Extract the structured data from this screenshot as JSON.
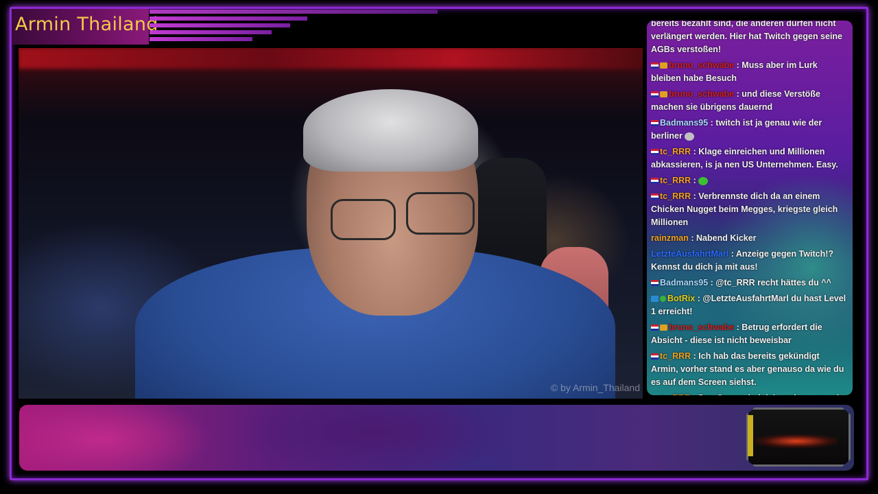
{
  "stream": {
    "title": "Armin Thailand",
    "watermark": "© by Armin_Thailand"
  },
  "chat": {
    "messages": [
      {
        "user": "",
        "color": "#ffffff",
        "text": "bereits bezahlt sind, die anderen dürfen nicht verlängert werden. Hier hat Twitch gegen seine AGBs verstoßen!",
        "badges": []
      },
      {
        "user": "bruno_schwabe",
        "color": "#cc2020",
        "text": ": Muss aber im Lurk bleiben habe Besuch",
        "badges": [
          "flag-icon",
          "crown-icon"
        ]
      },
      {
        "user": "bruno_schwabe",
        "color": "#cc2020",
        "text": ": und diese Verstöße machen sie übrigens dauernd",
        "badges": [
          "flag-icon",
          "crown-icon"
        ]
      },
      {
        "user": "Badmans95",
        "color": "#a8d8ff",
        "text": ": twitch ist ja genau wie der berliner",
        "badges": [
          "flag-icon"
        ],
        "emote": "small-emote-icon"
      },
      {
        "user": "tc_RRR",
        "color": "#f0a020",
        "text": ": Klage einreichen und Millionen abkassieren, is ja nen US Unternehmen. Easy.",
        "badges": [
          "flag-icon"
        ]
      },
      {
        "user": "tc_RRR",
        "color": "#f0a020",
        "text": ":",
        "badges": [
          "flag-icon"
        ],
        "emote": "green-emote-icon"
      },
      {
        "user": "tc_RRR",
        "color": "#f0a020",
        "text": ": Verbrennste dich da an einem Chicken Nugget beim Megges, kriegste gleich Millionen",
        "badges": [
          "flag-icon"
        ]
      },
      {
        "user": "rainzman",
        "color": "#f0a020",
        "text": ": Nabend Kicker",
        "badges": []
      },
      {
        "user": "LetzteAusfahrtMarl",
        "color": "#2a6aff",
        "text": ": Anzeige gegen Twitch!? Kennst du dich ja mit aus!",
        "badges": []
      },
      {
        "user": "Badmans95",
        "color": "#a8d8ff",
        "text": ": @tc_RRR recht hättes du ^^",
        "badges": [
          "flag-icon"
        ]
      },
      {
        "user": "BotRix",
        "color": "#e0d020",
        "text": ": @LetzteAusfahrtMarl du hast Level 1 erreicht!",
        "badges": [
          "share-icon",
          "check-icon"
        ]
      },
      {
        "user": "bruno_schwabe",
        "color": "#cc2020",
        "text": ": Betrug erfordert die Absicht - diese ist nicht beweisbar",
        "badges": [
          "flag-icon",
          "crown-icon"
        ]
      },
      {
        "user": "tc_RRR",
        "color": "#f0a020",
        "text": ": Ich hab das bereits gekündigt Armin, vorher stand es aber genauso da wie du es auf dem Screen siehst.",
        "badges": [
          "flag-icon"
        ]
      },
      {
        "user": "tc_RRR",
        "color": "#f0a020",
        "text": ": Den Screen hab ich vorher gemacht.",
        "badges": [
          "flag-icon"
        ]
      }
    ]
  },
  "colors": {
    "title": "#f4c94a",
    "frame": "#8a2ad0"
  }
}
